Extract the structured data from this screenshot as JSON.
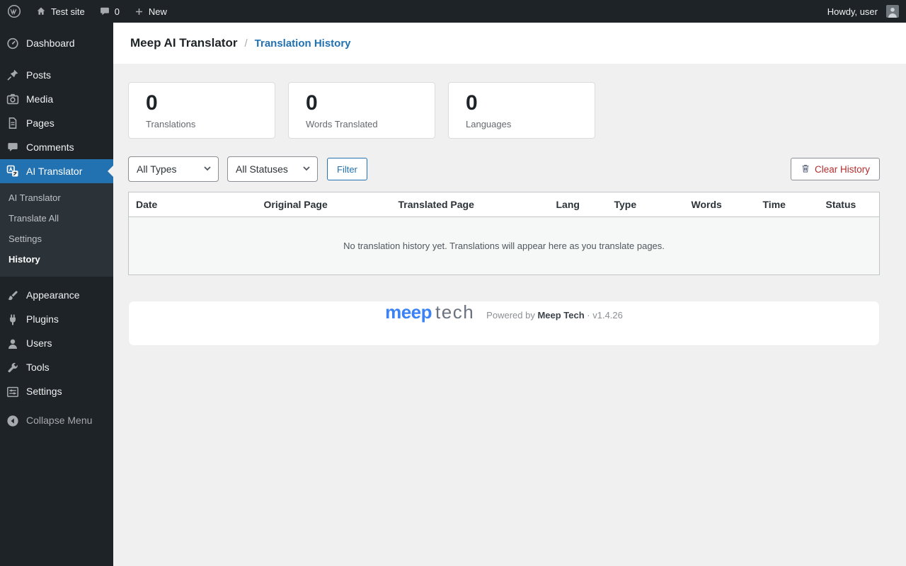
{
  "colors": {
    "accent": "#2271b1",
    "danger": "#b32d2e",
    "logo_blue": "#3b82f6",
    "admin_dark": "#1d2327"
  },
  "icons": [
    "wordpress-logo-icon",
    "home-icon",
    "comments-bubble-icon",
    "plus-icon",
    "avatar",
    "dashboard-icon",
    "posts-icon",
    "media-icon",
    "pages-icon",
    "comments-icon",
    "ai-translator-icon",
    "appearance-icon",
    "plugins-icon",
    "users-icon",
    "tools-icon",
    "settings-icon",
    "collapse-icon",
    "chevron-down-icon",
    "trash-icon"
  ],
  "admin_bar": {
    "site_name": "Test site",
    "comments_count": "0",
    "new_label": "New",
    "howdy": "Howdy, user"
  },
  "sidebar": {
    "items": [
      {
        "label": "Dashboard"
      },
      {
        "label": "Posts"
      },
      {
        "label": "Media"
      },
      {
        "label": "Pages"
      },
      {
        "label": "Comments"
      },
      {
        "label": "AI Translator"
      },
      {
        "label": "Appearance"
      },
      {
        "label": "Plugins"
      },
      {
        "label": "Users"
      },
      {
        "label": "Tools"
      },
      {
        "label": "Settings"
      },
      {
        "label": "Collapse Menu"
      }
    ],
    "submenu": [
      "AI Translator",
      "Translate All",
      "Settings",
      "History"
    ]
  },
  "breadcrumb": {
    "title": "Meep AI Translator",
    "separator": "/",
    "current": "Translation History"
  },
  "stats": [
    {
      "value": "0",
      "label": "Translations"
    },
    {
      "value": "0",
      "label": "Words Translated"
    },
    {
      "value": "0",
      "label": "Languages"
    }
  ],
  "filters": {
    "type_select": "All Types",
    "status_select": "All Statuses",
    "filter_button": "Filter",
    "clear_button": "Clear History"
  },
  "table": {
    "headers": [
      "Date",
      "Original Page",
      "Translated Page",
      "Lang",
      "Type",
      "Words",
      "Time",
      "Status"
    ],
    "empty_message": "No translation history yet. Translations will appear here as you translate pages."
  },
  "footer": {
    "logo_meep": "meep",
    "logo_tech": "tech",
    "powered_prefix": "Powered by",
    "powered_brand": "Meep Tech",
    "version": "· v1.4.26"
  }
}
